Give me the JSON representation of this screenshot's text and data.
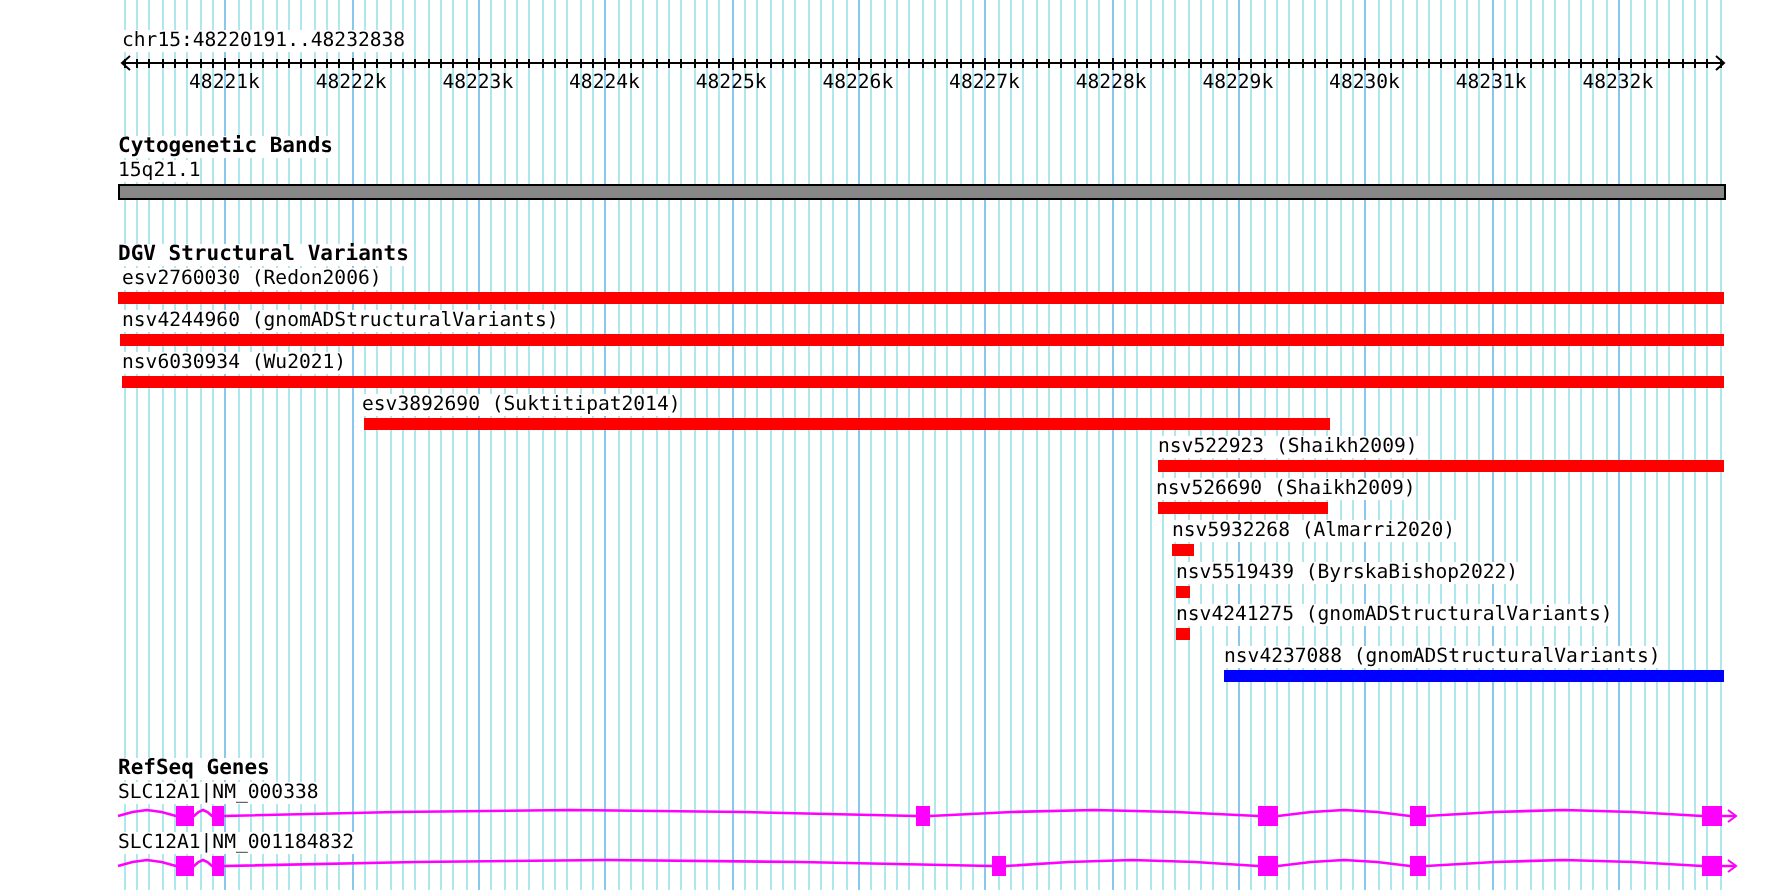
{
  "location": "chr15:48220191..48232838",
  "ruler": {
    "ticks": [
      "48221k",
      "48222k",
      "48223k",
      "48224k",
      "48225k",
      "48226k",
      "48227k",
      "48228k",
      "48229k",
      "48230k",
      "48231k",
      "48232k"
    ]
  },
  "tracks": [
    {
      "kind": "bands",
      "title": "Cytogenetic Bands",
      "features": [
        {
          "label": "15q21.1"
        }
      ]
    },
    {
      "kind": "variants",
      "title": "DGV Structural Variants",
      "features": [
        {
          "label": "esv2760030 (Redon2006)",
          "color": "#ff0000"
        },
        {
          "label": "nsv4244960 (gnomADStructuralVariants)",
          "color": "#ff0000"
        },
        {
          "label": "nsv6030934 (Wu2021)",
          "color": "#ff0000"
        },
        {
          "label": "esv3892690 (Suktitipat2014)",
          "color": "#ff0000"
        },
        {
          "label": "nsv522923 (Shaikh2009)",
          "color": "#ff0000"
        },
        {
          "label": "nsv526690 (Shaikh2009)",
          "color": "#ff0000"
        },
        {
          "label": "nsv5932268 (Almarri2020)",
          "color": "#ff0000"
        },
        {
          "label": "nsv5519439 (ByrskaBishop2022)",
          "color": "#ff0000"
        },
        {
          "label": "nsv4241275 (gnomADStructuralVariants)",
          "color": "#ff0000"
        },
        {
          "label": "nsv4237088 (gnomADStructuralVariants)",
          "color": "#0000ff"
        }
      ]
    },
    {
      "kind": "genes",
      "title": "RefSeq Genes",
      "features": [
        {
          "label": "SLC12A1|NM_000338"
        },
        {
          "label": "SLC12A1|NM_001184832"
        }
      ]
    }
  ]
}
